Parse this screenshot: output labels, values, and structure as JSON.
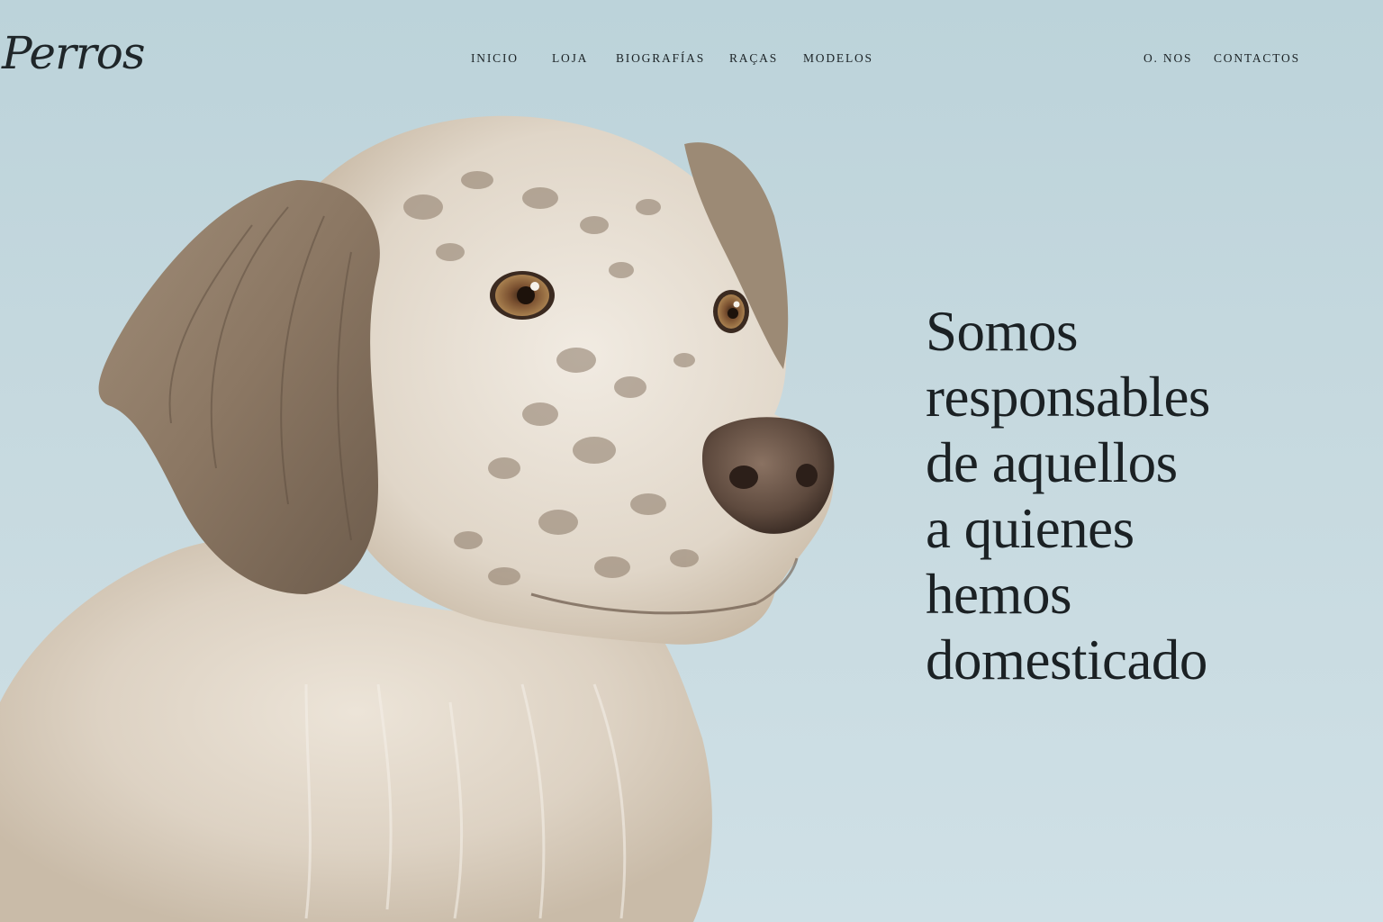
{
  "brand": {
    "logo_text": "Perros"
  },
  "nav": {
    "primary": [
      "INICIO",
      "LOJA",
      "BIOGRAFÍAS",
      "RAÇAS",
      "MODELOS"
    ],
    "secondary": [
      "O. NOS",
      "CONTACTOS"
    ]
  },
  "hero": {
    "headline_lines": [
      "Somos",
      "responsables",
      "de aquellos",
      "a quienes",
      "hemos",
      "domesticado"
    ],
    "image": "dog-portrait",
    "background_color": "#c3d8df"
  }
}
